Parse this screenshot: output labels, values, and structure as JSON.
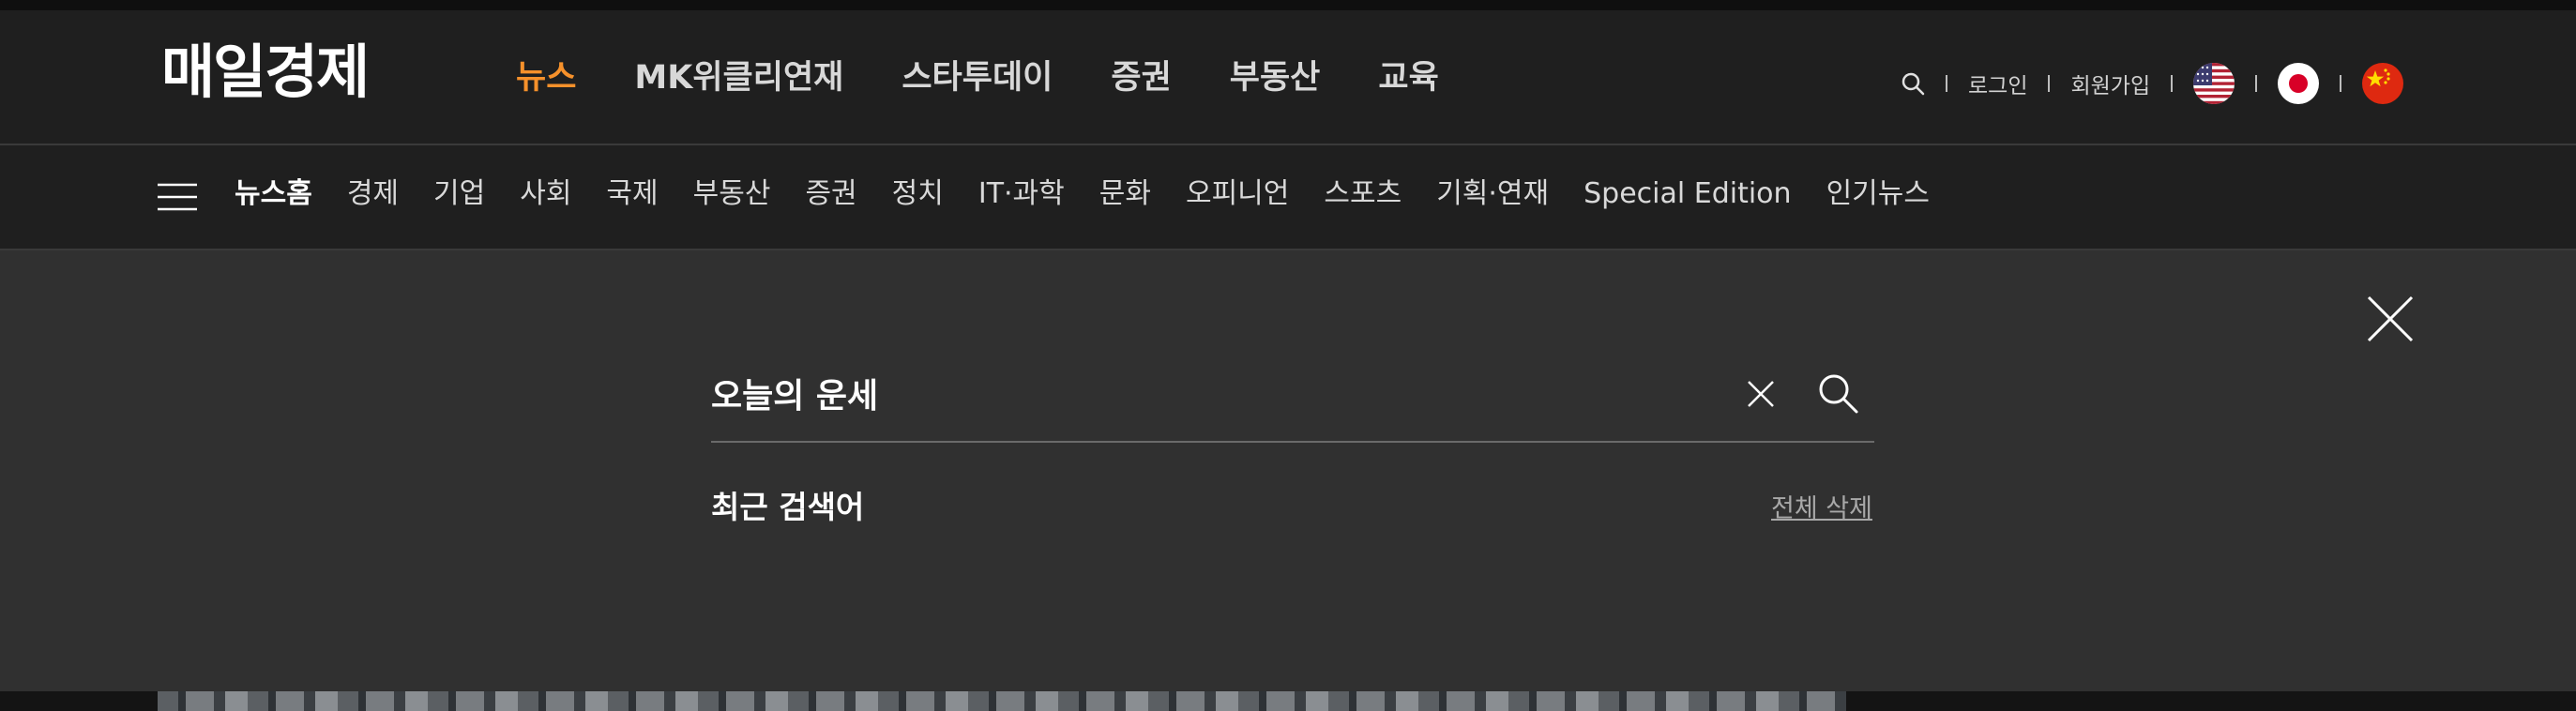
{
  "header": {
    "logo": "매일경제",
    "nav": [
      "뉴스",
      "MK위클리연재",
      "스타투데이",
      "증권",
      "부동산",
      "교육"
    ],
    "active_nav": "뉴스",
    "utility": {
      "login": "로그인",
      "signup": "회원가입",
      "flags": [
        "us-flag-icon",
        "jp-flag-icon",
        "cn-flag-icon"
      ]
    }
  },
  "subnav": {
    "items": [
      "뉴스홈",
      "경제",
      "기업",
      "사회",
      "국제",
      "부동산",
      "증권",
      "정치",
      "IT·과학",
      "문화",
      "오피니언",
      "스포츠",
      "기획·연재",
      "Special Edition",
      "인기뉴스"
    ]
  },
  "search": {
    "value": "오늘의 운세",
    "recent_title": "최근 검색어",
    "delete_all": "전체 삭제"
  },
  "colors": {
    "accent": "#f6912b",
    "header_bg": "#1f1f1f",
    "panel_bg": "#303030"
  }
}
